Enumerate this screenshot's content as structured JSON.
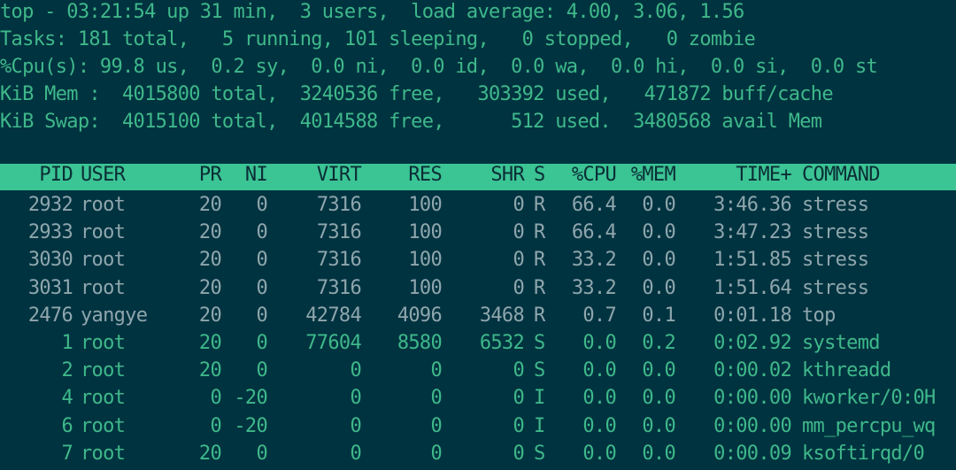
{
  "summary": {
    "line1": "top - 03:21:54 up 31 min,  3 users,  load average: 4.00, 3.06, 1.56",
    "line2": "Tasks: 181 total,   5 running, 101 sleeping,   0 stopped,   0 zombie",
    "line3": "%Cpu(s): 99.8 us,  0.2 sy,  0.0 ni,  0.0 id,  0.0 wa,  0.0 hi,  0.0 si,  0.0 st",
    "line4": "KiB Mem :  4015800 total,  3240536 free,   303392 used,   471872 buff/cache",
    "line5": "KiB Swap:  4015100 total,  4014588 free,      512 used.  3480568 avail Mem"
  },
  "columns": {
    "pid": "PID",
    "user": "USER",
    "pr": "PR",
    "ni": "NI",
    "virt": "VIRT",
    "res": "RES",
    "shr": "SHR",
    "s": "S",
    "cpu": "%CPU",
    "mem": "%MEM",
    "time": "TIME+",
    "command": "COMMAND"
  },
  "processes": [
    {
      "pid": "2932",
      "user": "root",
      "pr": "20",
      "ni": "0",
      "virt": "7316",
      "res": "100",
      "shr": "0",
      "s": "R",
      "cpu": "66.4",
      "mem": "0.0",
      "time": "3:46.36",
      "command": "stress"
    },
    {
      "pid": "2933",
      "user": "root",
      "pr": "20",
      "ni": "0",
      "virt": "7316",
      "res": "100",
      "shr": "0",
      "s": "R",
      "cpu": "66.4",
      "mem": "0.0",
      "time": "3:47.23",
      "command": "stress"
    },
    {
      "pid": "3030",
      "user": "root",
      "pr": "20",
      "ni": "0",
      "virt": "7316",
      "res": "100",
      "shr": "0",
      "s": "R",
      "cpu": "33.2",
      "mem": "0.0",
      "time": "1:51.85",
      "command": "stress"
    },
    {
      "pid": "3031",
      "user": "root",
      "pr": "20",
      "ni": "0",
      "virt": "7316",
      "res": "100",
      "shr": "0",
      "s": "R",
      "cpu": "33.2",
      "mem": "0.0",
      "time": "1:51.64",
      "command": "stress"
    },
    {
      "pid": "2476",
      "user": "yangye",
      "pr": "20",
      "ni": "0",
      "virt": "42784",
      "res": "4096",
      "shr": "3468",
      "s": "R",
      "cpu": "0.7",
      "mem": "0.1",
      "time": "0:01.18",
      "command": "top"
    },
    {
      "pid": "1",
      "user": "root",
      "pr": "20",
      "ni": "0",
      "virt": "77604",
      "res": "8580",
      "shr": "6532",
      "s": "S",
      "cpu": "0.0",
      "mem": "0.2",
      "time": "0:02.92",
      "command": "systemd"
    },
    {
      "pid": "2",
      "user": "root",
      "pr": "20",
      "ni": "0",
      "virt": "0",
      "res": "0",
      "shr": "0",
      "s": "S",
      "cpu": "0.0",
      "mem": "0.0",
      "time": "0:00.02",
      "command": "kthreadd"
    },
    {
      "pid": "4",
      "user": "root",
      "pr": "0",
      "ni": "-20",
      "virt": "0",
      "res": "0",
      "shr": "0",
      "s": "I",
      "cpu": "0.0",
      "mem": "0.0",
      "time": "0:00.00",
      "command": "kworker/0:0H"
    },
    {
      "pid": "6",
      "user": "root",
      "pr": "0",
      "ni": "-20",
      "virt": "0",
      "res": "0",
      "shr": "0",
      "s": "I",
      "cpu": "0.0",
      "mem": "0.0",
      "time": "0:00.00",
      "command": "mm_percpu_wq"
    },
    {
      "pid": "7",
      "user": "root",
      "pr": "20",
      "ni": "0",
      "virt": "0",
      "res": "0",
      "shr": "0",
      "s": "S",
      "cpu": "0.0",
      "mem": "0.0",
      "time": "0:00.09",
      "command": "ksoftirqd/0"
    }
  ],
  "colors": {
    "background": "#003340",
    "text": "#3fb88a",
    "header_bar": "#3bc494",
    "header_text": "#0b2d35",
    "active_row_text": "#8fa6ad"
  }
}
